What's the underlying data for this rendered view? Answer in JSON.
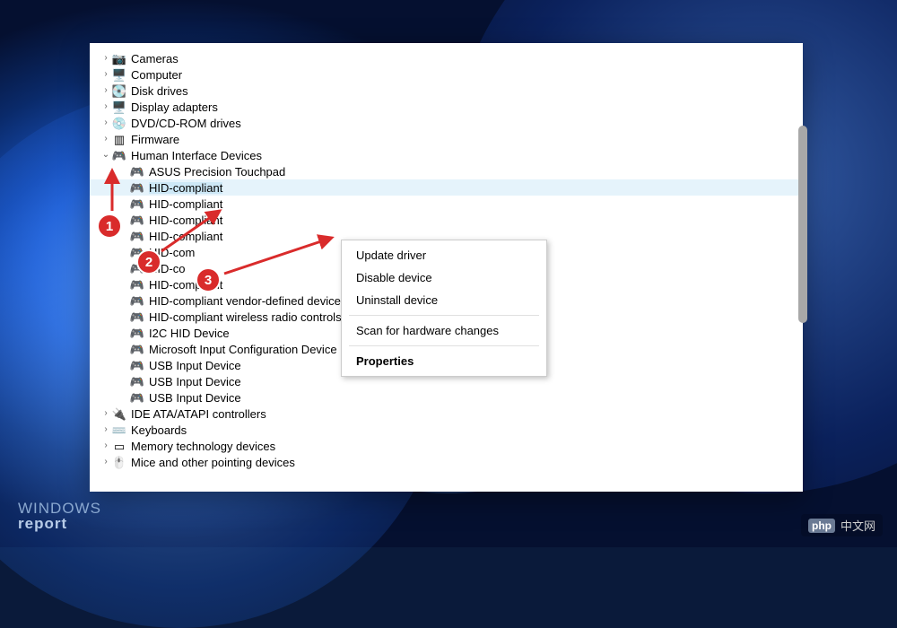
{
  "tree": {
    "top_level": [
      {
        "chevron": "›",
        "icon": "📷",
        "label": "Cameras"
      },
      {
        "chevron": "›",
        "icon": "🖥️",
        "label": "Computer"
      },
      {
        "chevron": "›",
        "icon": "💽",
        "label": "Disk drives"
      },
      {
        "chevron": "›",
        "icon": "🖥️",
        "label": "Display adapters"
      },
      {
        "chevron": "›",
        "icon": "💿",
        "label": "DVD/CD-ROM drives"
      },
      {
        "chevron": "›",
        "icon": "▥",
        "label": "Firmware"
      }
    ],
    "expanded": {
      "chevron": "⌄",
      "icon": "🎮",
      "label": "Human Interface Devices",
      "children": [
        {
          "icon": "🎮",
          "label": "ASUS Precision Touchpad",
          "selected": false
        },
        {
          "icon": "🎮",
          "label": "HID-compliant",
          "selected": true
        },
        {
          "icon": "🎮",
          "label": "HID-compliant",
          "selected": false
        },
        {
          "icon": "🎮",
          "label": "HID-compliant",
          "selected": false
        },
        {
          "icon": "🎮",
          "label": "HID-compliant",
          "selected": false
        },
        {
          "icon": "🎮",
          "label": "HID-com",
          "selected": false
        },
        {
          "icon": "🎮",
          "label": "HID-co",
          "selected": false
        },
        {
          "icon": "🎮",
          "label": "HID-compliant",
          "selected": false
        },
        {
          "icon": "🎮",
          "label": "HID-compliant vendor-defined device",
          "selected": false
        },
        {
          "icon": "🎮",
          "label": "HID-compliant wireless radio controls",
          "selected": false
        },
        {
          "icon": "🎮",
          "label": "I2C HID Device",
          "selected": false
        },
        {
          "icon": "🎮",
          "label": "Microsoft Input Configuration Device",
          "selected": false
        },
        {
          "icon": "🎮",
          "label": "USB Input Device",
          "selected": false
        },
        {
          "icon": "🎮",
          "label": "USB Input Device",
          "selected": false
        },
        {
          "icon": "🎮",
          "label": "USB Input Device",
          "selected": false
        }
      ]
    },
    "bottom_level": [
      {
        "chevron": "›",
        "icon": "🔌",
        "label": "IDE ATA/ATAPI controllers"
      },
      {
        "chevron": "›",
        "icon": "⌨️",
        "label": "Keyboards"
      },
      {
        "chevron": "›",
        "icon": "▭",
        "label": "Memory technology devices"
      },
      {
        "chevron": "›",
        "icon": "🖱️",
        "label": "Mice and other pointing devices"
      }
    ]
  },
  "context_menu": {
    "items": [
      {
        "label": "Update driver",
        "bold": false
      },
      {
        "label": "Disable device",
        "bold": false
      },
      {
        "label": "Uninstall device",
        "bold": false
      }
    ],
    "items2": [
      {
        "label": "Scan for hardware changes",
        "bold": false
      }
    ],
    "items3": [
      {
        "label": "Properties",
        "bold": true
      }
    ]
  },
  "callouts": {
    "c1": "1",
    "c2": "2",
    "c3": "3"
  },
  "watermarks": {
    "left_line1": "WINDOWS",
    "left_line2": "report",
    "right_badge": "php",
    "right_text": "中文网"
  }
}
